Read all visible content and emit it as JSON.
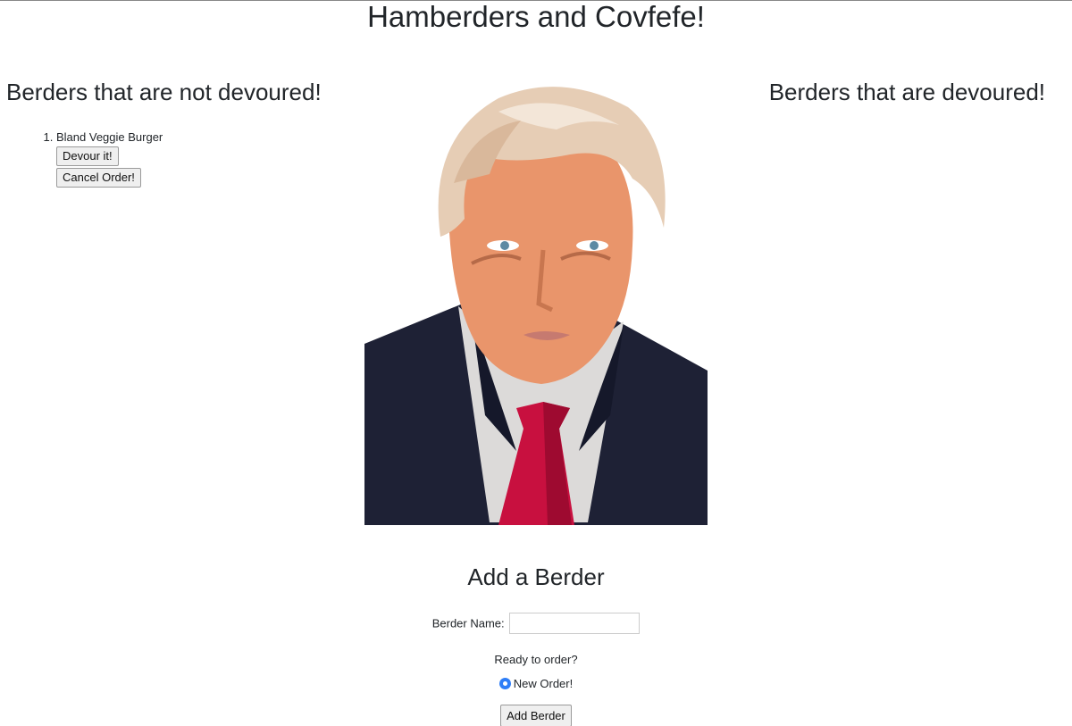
{
  "page": {
    "title": "Hamberders and Covfefe!"
  },
  "not_devoured": {
    "heading": "Berders that are not devoured!",
    "items": [
      {
        "number": "1.",
        "name": "Bland Veggie Burger",
        "devour_label": "Devour it!",
        "cancel_label": "Cancel Order!"
      }
    ]
  },
  "devoured": {
    "heading": "Berders that are devoured!",
    "items": []
  },
  "form": {
    "heading": "Add a Berder",
    "name_label": "Berder Name:",
    "name_value": "",
    "ready_label": "Ready to order?",
    "radio_label": "New Order!",
    "radio_checked": true,
    "submit_label": "Add Berder"
  },
  "colors": {
    "text": "#212529",
    "radio_accent": "#2f7ef7",
    "suit": "#1e2135",
    "tie": "#c8103f",
    "skin": "#e9956b",
    "hair": "#e6cdb5"
  }
}
